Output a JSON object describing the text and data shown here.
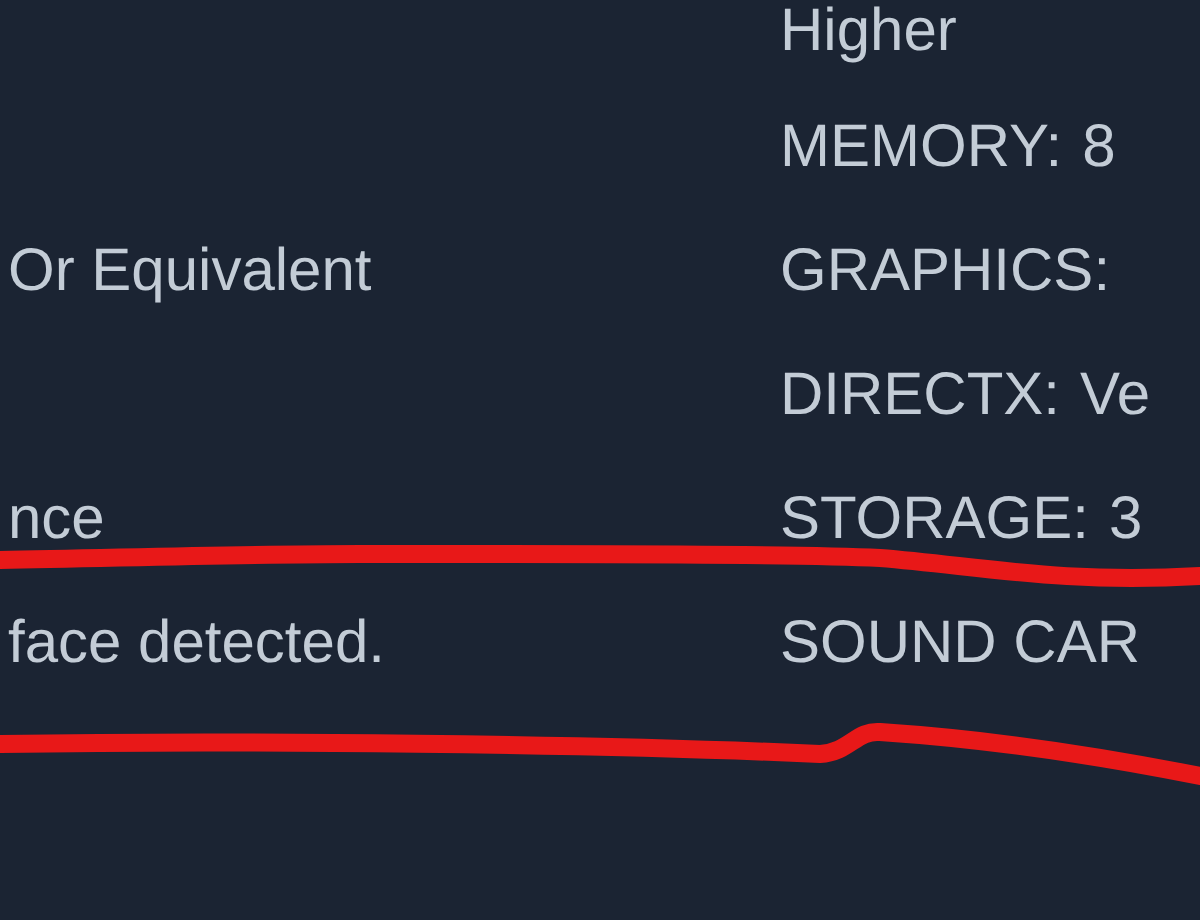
{
  "rows": [
    {
      "right": "Higher"
    },
    {
      "label": "MEMORY:",
      "value": "8"
    },
    {
      "left": "Or Equivalent",
      "label": "GRAPHICS:"
    },
    {
      "label": "DIRECTX:",
      "value": "Ve"
    },
    {
      "left": "nce",
      "label": "STORAGE:",
      "value": "3"
    },
    {
      "left": "face detected.",
      "label": "SOUND CAR"
    }
  ]
}
